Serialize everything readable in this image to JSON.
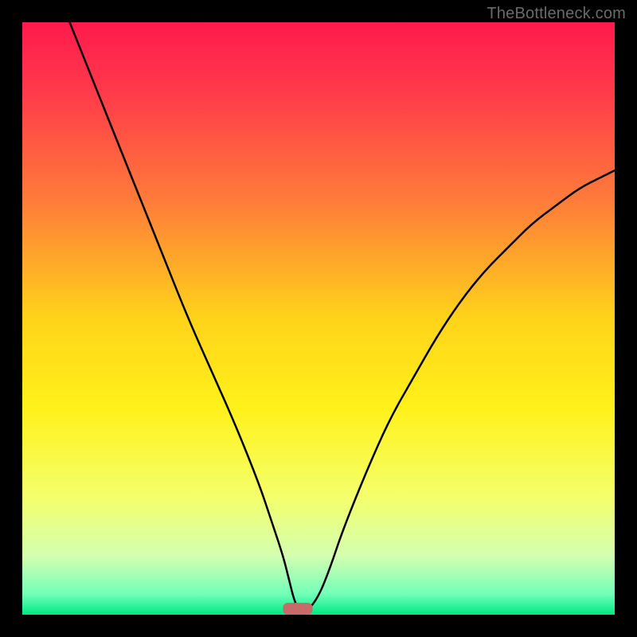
{
  "watermark": "TheBottleneck.com",
  "chart_data": {
    "type": "line",
    "title": "",
    "xlabel": "",
    "ylabel": "",
    "xlim": [
      0,
      100
    ],
    "ylim": [
      0,
      100
    ],
    "gradient_stops": [
      {
        "offset": 0.0,
        "color": "#ff1a4d"
      },
      {
        "offset": 0.12,
        "color": "#ff3b4a"
      },
      {
        "offset": 0.3,
        "color": "#ff7b3a"
      },
      {
        "offset": 0.5,
        "color": "#ffd31a"
      },
      {
        "offset": 0.65,
        "color": "#fff11a"
      },
      {
        "offset": 0.8,
        "color": "#f4ff6a"
      },
      {
        "offset": 0.9,
        "color": "#d4ffb0"
      },
      {
        "offset": 0.965,
        "color": "#72ffb8"
      },
      {
        "offset": 1.0,
        "color": "#00e884"
      }
    ],
    "series": [
      {
        "name": "bottleneck-curve",
        "x": [
          8,
          12,
          16,
          20,
          24,
          28,
          32,
          36,
          40,
          42,
          44,
          45,
          46,
          47,
          48,
          50,
          52,
          54,
          58,
          62,
          66,
          70,
          74,
          78,
          82,
          86,
          90,
          94,
          98,
          100
        ],
        "y": [
          100,
          90,
          80,
          70,
          60,
          50,
          41,
          32,
          22,
          16,
          10,
          6,
          2,
          0.5,
          0.5,
          3,
          8,
          14,
          24,
          33,
          40,
          47,
          53,
          58,
          62,
          66,
          69,
          72,
          74,
          75
        ]
      }
    ],
    "marker": {
      "name": "minimum-marker",
      "x": 46.5,
      "y": 0,
      "color": "#c76a6a",
      "width": 5,
      "height": 2
    }
  }
}
